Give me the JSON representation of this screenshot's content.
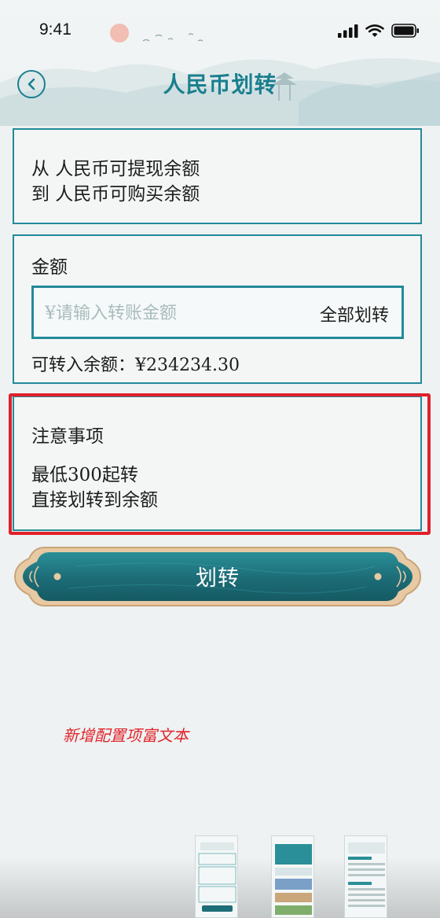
{
  "status_bar": {
    "time": "9:41"
  },
  "header": {
    "title": "人民币划转"
  },
  "transfer_direction": {
    "from_label": "从 人民币可提现余额",
    "to_label": "到 人民币可购买余额"
  },
  "amount": {
    "label": "金额",
    "placeholder": "¥请输入转账金额",
    "all_transfer_label": "全部划转",
    "available_balance": "可转入余额：¥234234.30"
  },
  "notes": {
    "title": "注意事项",
    "items": [
      "最低300起转",
      "直接划转到余额"
    ]
  },
  "action_button": {
    "label": "划转"
  },
  "annotation": {
    "text": "新增配置项富文本"
  },
  "colors": {
    "accent": "#238a9a",
    "button": "#1f6f79",
    "highlight": "#e0202a",
    "annotation": "#e2242b"
  }
}
